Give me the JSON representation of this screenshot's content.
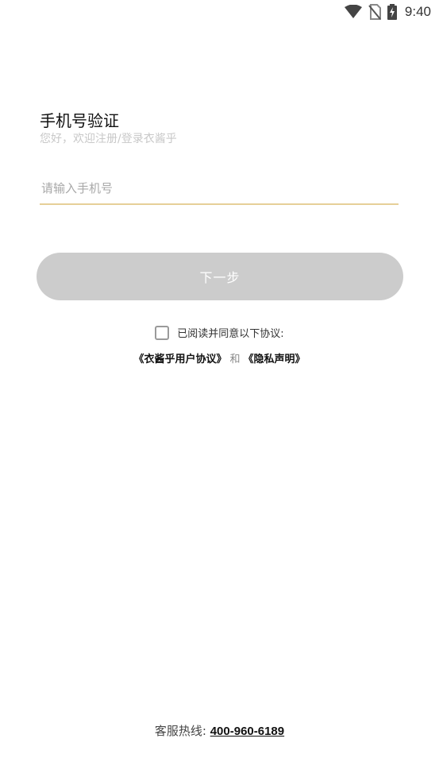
{
  "status_bar": {
    "time": "9:40",
    "icons": [
      "wifi-icon",
      "no-sim-icon",
      "battery-charging-icon"
    ]
  },
  "page": {
    "title": "手机号验证",
    "subtitle": "您好，欢迎注册/登录衣酱乎"
  },
  "phone_input": {
    "value": "",
    "placeholder": "请输入手机号",
    "underline_color": "#e6cf98"
  },
  "next_button": {
    "label": "下一步",
    "color": "#cccccc"
  },
  "agreement": {
    "checked": false,
    "prompt": "已阅读并同意以下协议:",
    "user_agreement": "《衣酱乎用户协议》",
    "and": "和",
    "privacy": "《隐私声明》"
  },
  "hotline": {
    "label": "客服热线:",
    "number": "400-960-6189"
  }
}
